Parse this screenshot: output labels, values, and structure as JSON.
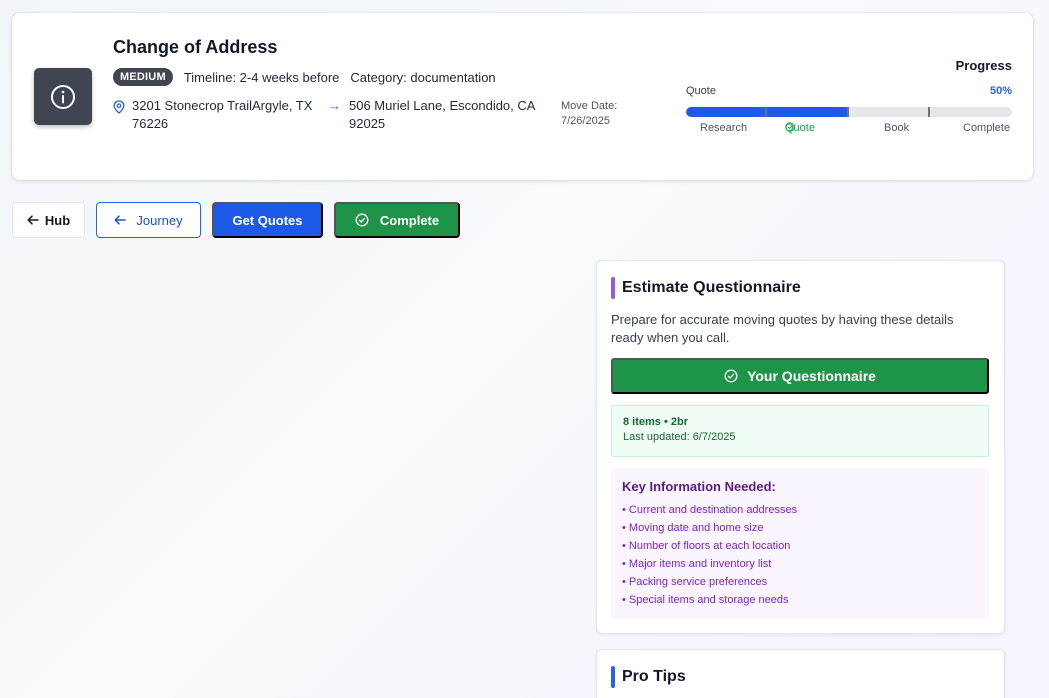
{
  "header": {
    "title": "Change of Address",
    "priority_badge": "MEDIUM",
    "timeline": "Timeline: 2-4 weeks before",
    "category": "Category: documentation",
    "from_address": "3201 Stonecrop TrailArgyle, TX 76226",
    "to_address": "506 Muriel Lane, Escondido, CA 92025",
    "arrow": "→",
    "move_date_label": "Move Date:",
    "move_date_value": "7/26/2025",
    "icon": "info-circle-icon"
  },
  "progress": {
    "title": "Progress",
    "stage": "Quote",
    "percent_label": "50%",
    "percent_value": 50,
    "fill_color": "#1d5ae8",
    "steps": [
      "Research",
      "Quote",
      "Book",
      "Complete"
    ],
    "active_step": "Quote"
  },
  "toolbar": {
    "hub_label": "Hub",
    "journey_label": "Journey",
    "quotes_label": "Get Quotes",
    "complete_label": "Complete"
  },
  "questionnaire": {
    "title": "Estimate Questionnaire",
    "accent_color": "#9b59d6",
    "description": "Prepare for accurate moving quotes by having these details ready when you call.",
    "button_label": "Your Questionnaire",
    "status_items": "8 items • 2br",
    "status_updated": "Last updated: 6/7/2025",
    "key_title": "Key Information Needed:",
    "key_items": [
      "• Current and destination addresses",
      "• Moving date and home size",
      "• Number of floors at each location",
      "• Major items and inventory list",
      "• Packing service preferences",
      "• Special items and storage needs"
    ]
  },
  "tips": {
    "title": "Pro Tips",
    "accent_color": "#2563eb"
  },
  "colors": {
    "primary_blue": "#1d5ae8",
    "success_green": "#1e9448",
    "badge_dark": "#3f4652"
  }
}
